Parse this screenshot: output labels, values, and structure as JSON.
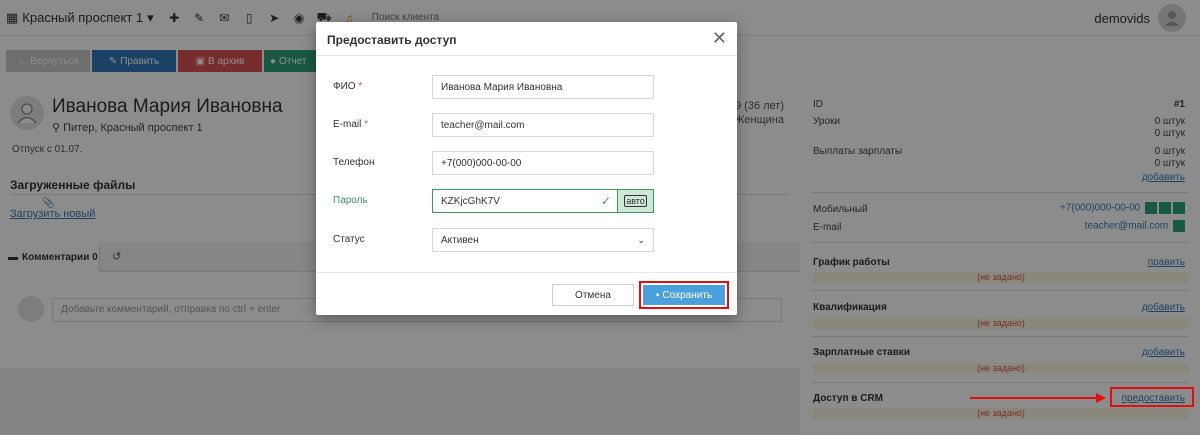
{
  "topbar": {
    "branch": "Красный проспект 1",
    "search_label": "Поиск клиента",
    "user": "demovids"
  },
  "toolbar": {
    "back": "Вернуться",
    "edit": "Править",
    "archive": "В архив",
    "report": "Отчет"
  },
  "profile": {
    "name": "Иванова Мария Ивановна",
    "location": "Питер, Красный проспект 1",
    "birthdate": "89 (36 лет)",
    "gender": "Женщина",
    "vacation": "Отпуск с 01.07.",
    "files_title": "Загруженные файлы",
    "upload_link": "Загрузить новый"
  },
  "tabs": {
    "comments": "Комментарии 0",
    "comment_placeholder": "Добавьте комментарий, отправка по ctrl + enter"
  },
  "right_panel": {
    "id_label": "ID",
    "id_value": "#1",
    "lessons_label": "Уроки",
    "lessons_v1": "0 штук",
    "lessons_v2": "0 штук",
    "salary_label": "Выплаты зарплаты",
    "salary_v1": "0 штук",
    "salary_v2": "0 штук",
    "add": "добавить",
    "mobile_label": "Мобильный",
    "mobile_value": "+7(000)000-00-00",
    "email_label": "E-mail",
    "email_value": "teacher@mail.com",
    "schedule_label": "График работы",
    "edit_link": "править",
    "unset": "(не задано)",
    "qualification_label": "Квалификация",
    "rates_label": "Зарплатные ставки",
    "crm_label": "Доступ в CRM",
    "grant_link": "предоставить"
  },
  "modal": {
    "title": "Предоставить доступ",
    "fio_label": "ФИО",
    "fio_value": "Иванова Мария Ивановна",
    "email_label": "E-mail",
    "email_value": "teacher@mail.com",
    "phone_label": "Телефон",
    "phone_value": "+7(000)000-00-00",
    "password_label": "Пароль",
    "password_value": "KZKjcGhK7V",
    "auto_label": "авто",
    "status_label": "Статус",
    "status_value": "Активен",
    "required_mark": "*",
    "cancel": "Отмена",
    "save": "Сохранить"
  }
}
